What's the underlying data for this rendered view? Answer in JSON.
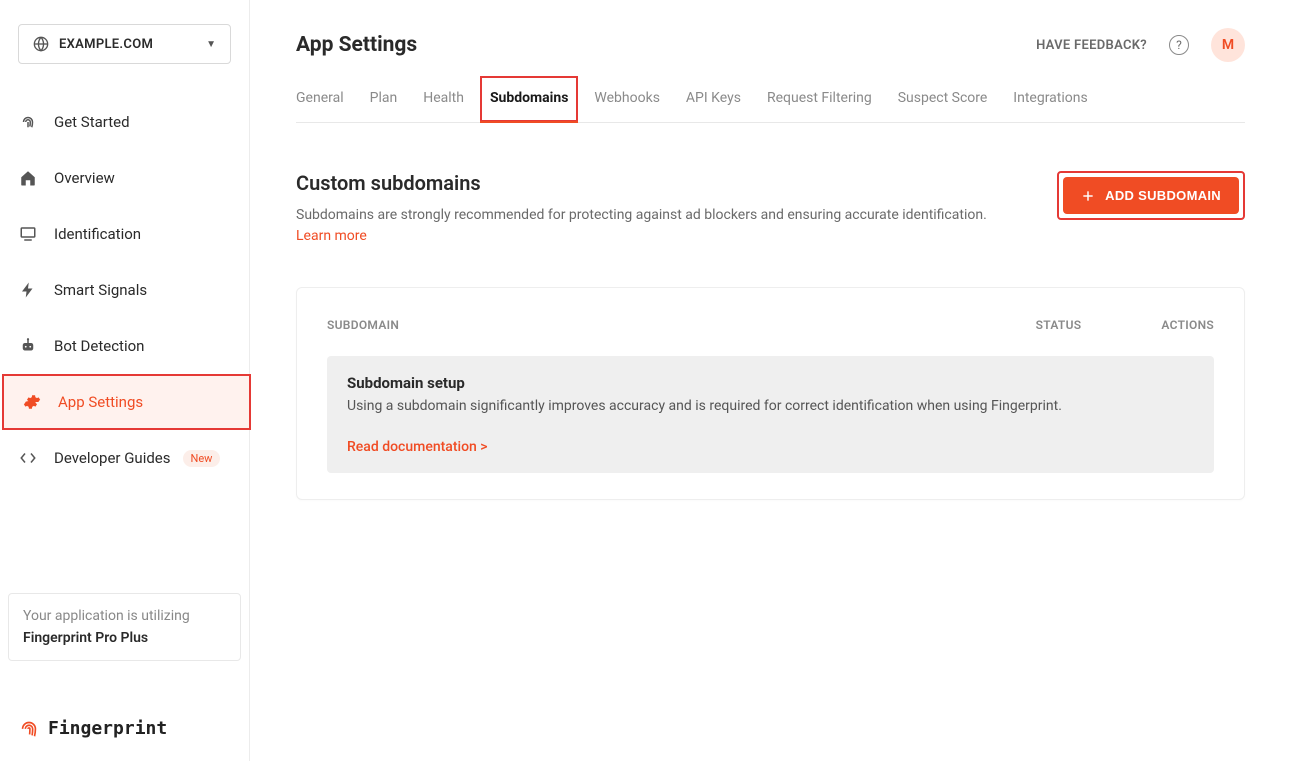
{
  "sidebar": {
    "site_label": "EXAMPLE.COM",
    "items": [
      {
        "label": "Get Started"
      },
      {
        "label": "Overview"
      },
      {
        "label": "Identification"
      },
      {
        "label": "Smart Signals"
      },
      {
        "label": "Bot Detection"
      },
      {
        "label": "App Settings"
      },
      {
        "label": "Developer Guides",
        "badge": "New"
      }
    ],
    "plan_line1": "Your application is utilizing",
    "plan_line2": "Fingerprint Pro Plus",
    "brand_name": "Fingerprint"
  },
  "header": {
    "title": "App Settings",
    "feedback_label": "HAVE FEEDBACK?",
    "avatar_letter": "M"
  },
  "tabs": [
    {
      "label": "General"
    },
    {
      "label": "Plan"
    },
    {
      "label": "Health"
    },
    {
      "label": "Subdomains",
      "active": true
    },
    {
      "label": "Webhooks"
    },
    {
      "label": "API Keys"
    },
    {
      "label": "Request Filtering"
    },
    {
      "label": "Suspect Score"
    },
    {
      "label": "Integrations"
    }
  ],
  "section": {
    "title": "Custom subdomains",
    "description": "Subdomains are strongly recommended for protecting against ad blockers and ensuring accurate identification.",
    "learn_more": "Learn more",
    "add_button": "ADD SUBDOMAIN"
  },
  "table": {
    "col_subdomain": "SUBDOMAIN",
    "col_status": "STATUS",
    "col_actions": "ACTIONS",
    "notice_title": "Subdomain setup",
    "notice_body": "Using a subdomain significantly improves accuracy and is required for correct identification when using Fingerprint.",
    "notice_link": "Read documentation >"
  }
}
